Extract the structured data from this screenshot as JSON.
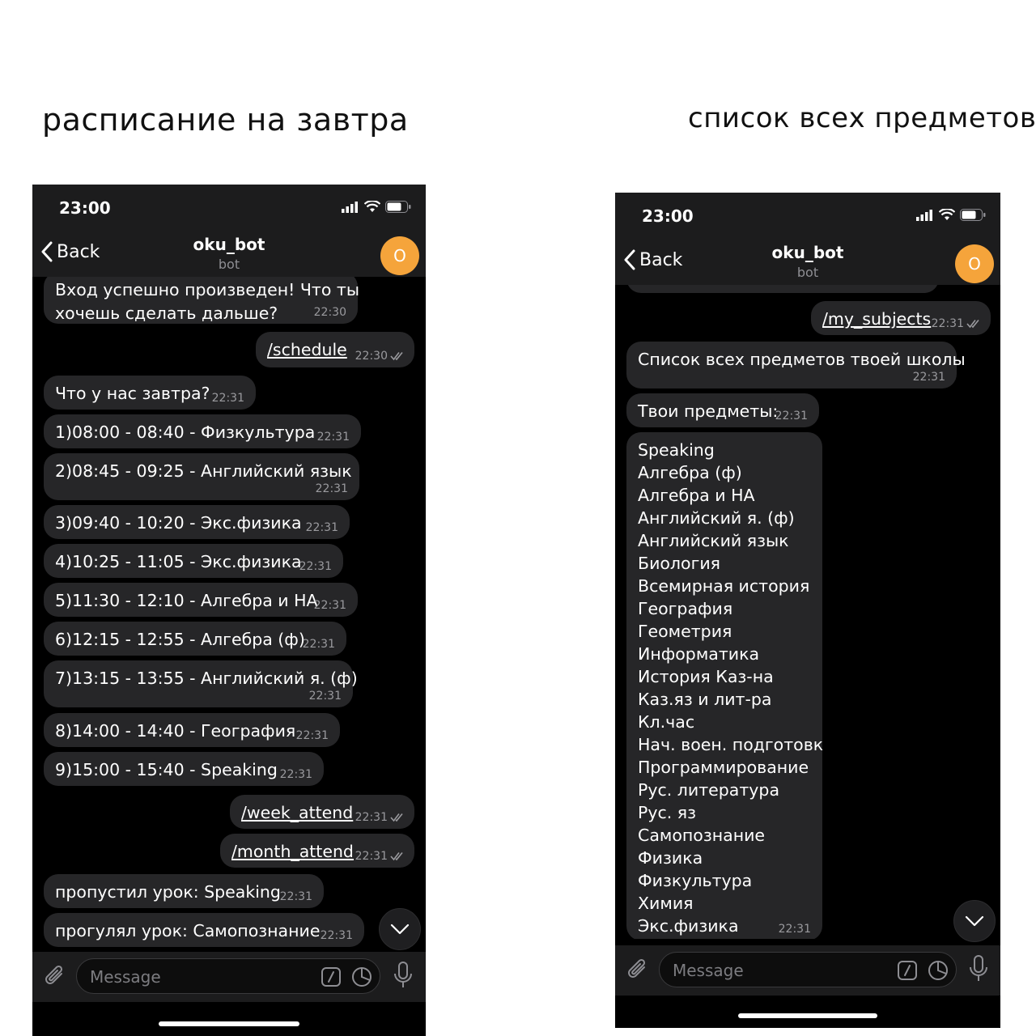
{
  "captions": {
    "left": "расписание на завтра",
    "right": "список всех предметов"
  },
  "phone1": {
    "status_time": "23:00",
    "back_label": "Back",
    "chat_title": "oku_bot",
    "chat_subtitle": "bot",
    "avatar_letter": "O",
    "messages": [
      {
        "text": "Вход успешно произведен! Что ты",
        "text2": "хочешь сделать дальше?",
        "time": "22:30"
      },
      {
        "text": "/schedule",
        "time": "22:30"
      },
      {
        "text": "Что у нас завтра?",
        "time": "22:31"
      },
      {
        "text": "1)08:00 - 08:40 - Физкультура",
        "time": "22:31"
      },
      {
        "text": "2)08:45 - 09:25 - Английский язык",
        "time": "22:31"
      },
      {
        "text": "3)09:40 - 10:20 - Экс.физика",
        "time": "22:31"
      },
      {
        "text": "4)10:25 - 11:05 - Экс.физика",
        "time": "22:31"
      },
      {
        "text": "5)11:30 - 12:10 - Алгебра и НА",
        "time": "22:31"
      },
      {
        "text": "6)12:15 - 12:55 - Алгебра (ф)",
        "time": "22:31"
      },
      {
        "text": "7)13:15 - 13:55 - Английский я. (ф)",
        "time": "22:31"
      },
      {
        "text": "8)14:00 - 14:40 - География",
        "time": "22:31"
      },
      {
        "text": "9)15:00 - 15:40 - Speaking",
        "time": "22:31"
      },
      {
        "text": "/week_attend",
        "time": "22:31"
      },
      {
        "text": "/month_attend",
        "time": "22:31"
      },
      {
        "text": "пропустил урок: Speaking",
        "time": "22:31"
      },
      {
        "text": "прогулял урок: Самопознание",
        "time": "22:31"
      }
    ],
    "input_placeholder": "Message"
  },
  "phone2": {
    "status_time": "23:00",
    "back_label": "Back",
    "chat_title": "oku_bot",
    "chat_subtitle": "bot",
    "avatar_letter": "O",
    "messages": [
      {
        "text": "/my_subjects",
        "time": "22:31"
      },
      {
        "text": "Список всех предметов твоей школы",
        "time": "22:31"
      },
      {
        "text": "Твои предметы:",
        "time": "22:31"
      }
    ],
    "subjects": [
      "Speaking",
      "Алгебра (ф)",
      "Алгебра и НА",
      "Английский я. (ф)",
      "Английский язык",
      "Биология",
      "Всемирная история",
      "География",
      "Геометрия",
      "Информатика",
      "История Каз-на",
      "Каз.яз и лит-ра",
      "Кл.час",
      "Нач. воен. подготовк",
      "Программирование",
      "Рус. литература",
      "Рус. яз",
      "Самопознание",
      "Физика",
      "Физкультура",
      "Химия",
      "Экс.физика"
    ],
    "subjects_time": "22:31",
    "input_placeholder": "Message"
  },
  "colors": {
    "avatar": "#f5a43b",
    "bubble": "#262628",
    "header": "#1c1c1d"
  },
  "icons": [
    "chevron-left-icon",
    "signal-icon",
    "wifi-icon",
    "battery-icon",
    "paperclip-icon",
    "slash-command-icon",
    "sticker-icon",
    "microphone-icon",
    "chevron-down-icon",
    "double-check-icon"
  ]
}
